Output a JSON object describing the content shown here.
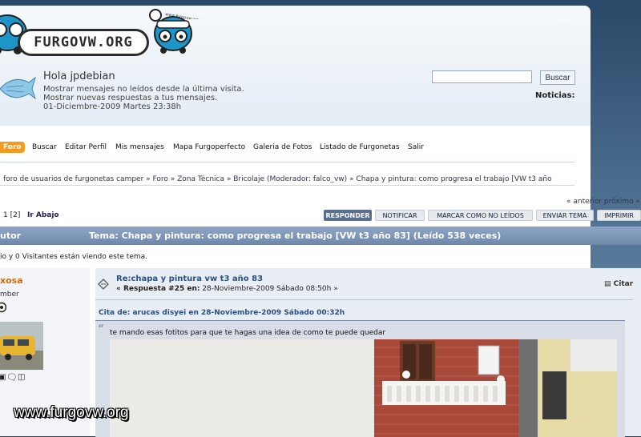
{
  "site": {
    "logo_text": "FURGOVW.ORG",
    "van_caption": "www.furgovw.org"
  },
  "header": {
    "greeting": "Hola jpdebian",
    "line1": "Mostrar mensajes no leídos desde la última visita.",
    "line2": "Mostrar nuevas respuestas a tus mensajes.",
    "date": "01-Diciembre-2009 Martes 23:38h",
    "search_button": "Buscar",
    "search_value": "",
    "noticias": "Noticias:"
  },
  "nav": [
    "Foro",
    "Buscar",
    "Editar Perfil",
    "Mis mensajes",
    "Mapa Furgoperfecto",
    "Galeria de Fotos",
    "Listado de Furgonetas",
    "Salir"
  ],
  "breadcrumb": "foro de usuarios de furgonetas camper » Foro » Zona Técnica » Bricolaje (Moderador: falco_vw) » Chapa y pintura: como progresa el trabajo [VW t3 año",
  "prevnext": "« anterior próximo »",
  "pagination": {
    "pages": "1 [2]",
    "go_down": "Ir Abajo"
  },
  "actions": [
    "RESPONDER",
    "NOTIFICAR",
    "MARCAR COMO NO LEÍDOS",
    "ENVIAR TEMA",
    "IMPRIMIR"
  ],
  "topic": {
    "autor_label": "utor",
    "title": "Tema: Chapa y pintura: como progresa el trabajo [VW t3 año 83]  (Leído 538 veces)"
  },
  "viewers": "io y 0 Visitantes están viendo este tema.",
  "post": {
    "author": "xosa",
    "rank": "mber",
    "subject": "Re:chapa y pintura vw t3 año 83",
    "reply_prefix": "« Respuesta #25 en:",
    "reply_date": " 28-Noviembre-2009 Sábado 08:50h »",
    "quote_button": "Citar",
    "quote_header": "Cita de: arucas disyei en 28-Noviembre-2009 Sábado 00:32h",
    "quote_text": "te mando esas  fotitos para que te hagas una idea de como te puede quedar"
  },
  "watermark": "www.furgovw.org",
  "colors": {
    "nav_active": "#f39a20",
    "title_bar": "#7d96b8",
    "link": "#2a4f80",
    "author": "#d46b0a"
  }
}
